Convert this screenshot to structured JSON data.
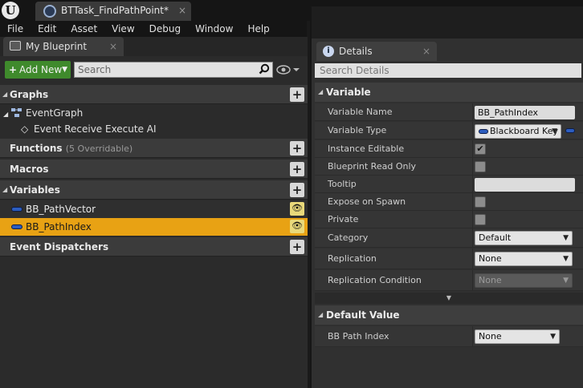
{
  "window": {
    "tab_title": "BTTask_FindPathPoint*",
    "tab_close": "×"
  },
  "menu": [
    "File",
    "Edit",
    "Asset",
    "View",
    "Debug",
    "Window",
    "Help"
  ],
  "my_blueprint": {
    "tab_label": "My Blueprint",
    "tab_close": "×",
    "add_new_label": "Add New",
    "search_placeholder": "Search",
    "sections": {
      "graphs": "Graphs",
      "event_graph": "EventGraph",
      "event_item": "Event Receive Execute AI",
      "functions": "Functions",
      "functions_sub": "(5 Overridable)",
      "macros": "Macros",
      "variables": "Variables",
      "event_dispatchers": "Event Dispatchers"
    },
    "variables": [
      {
        "name": "BB_PathVector",
        "selected": false
      },
      {
        "name": "BB_PathIndex",
        "selected": true
      }
    ]
  },
  "details": {
    "tab_label": "Details",
    "tab_close": "×",
    "search_placeholder": "Search Details",
    "variable_section": "Variable",
    "props": {
      "variable_name_label": "Variable Name",
      "variable_name_value": "BB_PathIndex",
      "variable_type_label": "Variable Type",
      "variable_type_value": "Blackboard Key",
      "instance_editable_label": "Instance Editable",
      "instance_editable_check": "✔",
      "blueprint_read_only_label": "Blueprint Read Only",
      "tooltip_label": "Tooltip",
      "tooltip_value": "",
      "expose_on_spawn_label": "Expose on Spawn",
      "private_label": "Private",
      "category_label": "Category",
      "category_value": "Default",
      "replication_label": "Replication",
      "replication_value": "None",
      "replication_condition_label": "Replication Condition",
      "replication_condition_value": "None"
    },
    "default_value_section": "Default Value",
    "bb_path_index_label": "BB Path Index",
    "bb_path_index_value": "None"
  },
  "colors": {
    "selected_row": "#e8a214",
    "add_new_green": "#3f8a2c",
    "variable_pill_blue": "#2c5dbf"
  }
}
